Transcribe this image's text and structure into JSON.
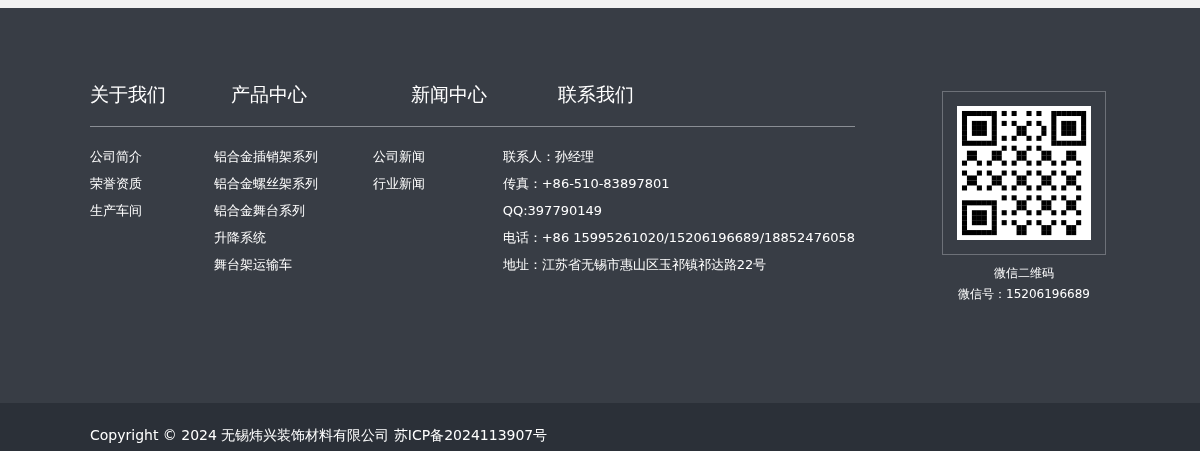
{
  "columns": [
    {
      "title": "关于我们",
      "links": [
        "公司简介",
        "荣誉资质",
        "生产车间"
      ]
    },
    {
      "title": "产品中心",
      "links": [
        "铝合金插销架系列",
        "铝合金螺丝架系列",
        "铝合金舞台系列",
        "升降系统",
        "舞台架运输车"
      ]
    },
    {
      "title": "新闻中心",
      "links": [
        "公司新闻",
        "行业新闻"
      ]
    }
  ],
  "contact": {
    "title": "联系我们",
    "lines": [
      "联系人：孙经理",
      "传真：+86-510-83897801",
      "QQ:397790149",
      "电话：+86 15995261020/15206196689/18852476058",
      "地址：江苏省无锡市惠山区玉祁镇祁达路22号"
    ]
  },
  "qr": {
    "caption": "微信二维码",
    "wechat": "微信号：15206196689"
  },
  "copyright": "Copyright © 2024 无锡炜兴装饰材料有限公司 苏ICP备2024113907号"
}
